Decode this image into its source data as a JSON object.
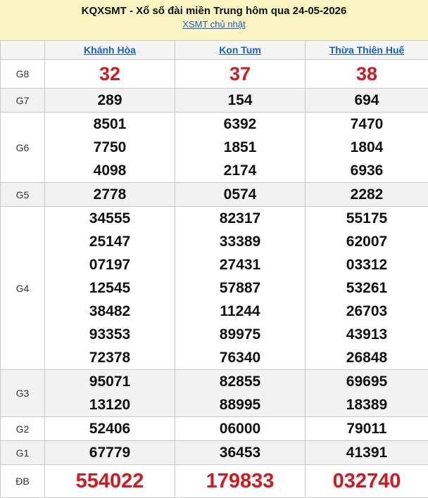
{
  "header": {
    "title": "KQXSMT - Xổ số đài miền Trung hôm qua 24-05-2026",
    "link": "XSMT chủ nhật"
  },
  "provinces": [
    "Khánh Hòa",
    "Kon Tum",
    "Thừa Thiên Huế"
  ],
  "prizes": {
    "g8": {
      "label": "G8",
      "values": [
        "32",
        "37",
        "38"
      ]
    },
    "g7": {
      "label": "G7",
      "values": [
        "289",
        "154",
        "694"
      ]
    },
    "g6": {
      "label": "G6",
      "values": [
        [
          "8501",
          "7750",
          "4098"
        ],
        [
          "6392",
          "1851",
          "2174"
        ],
        [
          "7470",
          "1804",
          "6936"
        ]
      ]
    },
    "g5": {
      "label": "G5",
      "values": [
        "2778",
        "0574",
        "2282"
      ]
    },
    "g4": {
      "label": "G4",
      "values": [
        [
          "34555",
          "25147",
          "07197",
          "12545",
          "38482",
          "93353",
          "72378"
        ],
        [
          "82317",
          "33389",
          "27431",
          "57887",
          "11244",
          "89975",
          "76340"
        ],
        [
          "55175",
          "62007",
          "03312",
          "53261",
          "26703",
          "43913",
          "26848"
        ]
      ]
    },
    "g3": {
      "label": "G3",
      "values": [
        [
          "95071",
          "13120"
        ],
        [
          "82855",
          "88995"
        ],
        [
          "69695",
          "18389"
        ]
      ]
    },
    "g2": {
      "label": "G2",
      "values": [
        "52406",
        "06000",
        "79011"
      ]
    },
    "g1": {
      "label": "G1",
      "values": [
        "67779",
        "36453",
        "41391"
      ]
    },
    "db": {
      "label": "ĐB",
      "values": [
        "554022",
        "179833",
        "032740"
      ]
    }
  },
  "colors": {
    "header_bg": "#fcf3c3",
    "link": "#1a5fc8",
    "red": "#d8161e",
    "alt_row": "#f2f2f2"
  }
}
